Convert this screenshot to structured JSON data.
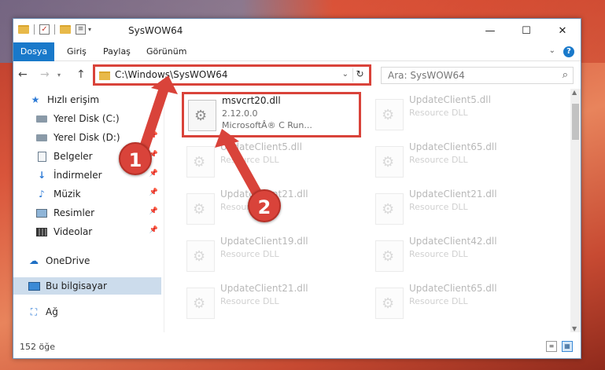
{
  "window": {
    "title": "SysWOW64",
    "minimize_glyph": "—",
    "maximize_glyph": "☐",
    "close_glyph": "✕"
  },
  "ribbon": {
    "tabs": [
      "Dosya",
      "Giriş",
      "Paylaş",
      "Görünüm"
    ],
    "help_glyph": "?"
  },
  "nav": {
    "back_glyph": "←",
    "forward_glyph": "→",
    "history_glyph": "▾",
    "up_glyph": "↑",
    "address": "C:\\Windows\\SysWOW64",
    "search_placeholder": "Ara: SysWOW64"
  },
  "sidebar": {
    "items": [
      {
        "label": "Hızlı erişim",
        "icon": "star-icon",
        "pinned": false
      },
      {
        "label": "Yerel Disk (C:)",
        "icon": "drive-icon",
        "pinned": true
      },
      {
        "label": "Yerel Disk (D:)",
        "icon": "drive-icon",
        "pinned": true
      },
      {
        "label": "Belgeler",
        "icon": "document-icon",
        "pinned": true
      },
      {
        "label": "İndirmeler",
        "icon": "download-icon",
        "pinned": true
      },
      {
        "label": "Müzik",
        "icon": "music-icon",
        "pinned": true
      },
      {
        "label": "Resimler",
        "icon": "picture-icon",
        "pinned": true
      },
      {
        "label": "Videolar",
        "icon": "video-icon",
        "pinned": true
      },
      {
        "label": "OneDrive",
        "icon": "cloud-icon",
        "pinned": false
      },
      {
        "label": "Bu bilgisayar",
        "icon": "computer-icon",
        "pinned": false,
        "selected": true
      },
      {
        "label": "Ağ",
        "icon": "network-icon",
        "pinned": false
      }
    ]
  },
  "files": {
    "highlighted": {
      "name": "msvcrt20.dll",
      "version": "2.12.0.0",
      "description": "MicrosoftÂ® C Run..."
    },
    "left_column": [
      {
        "name": "UpdateClient5.dll",
        "type": "Resource DLL"
      },
      {
        "name": "UpdateClient21.dll",
        "type": "Resource DLL"
      },
      {
        "name": "UpdateClient19.dll",
        "type": "Resource DLL"
      },
      {
        "name": "UpdateClient21.dll",
        "type": "Resource DLL"
      }
    ],
    "right_column": [
      {
        "name": "UpdateClient5.dll",
        "type": "Resource DLL"
      },
      {
        "name": "UpdateClient65.dll",
        "type": "Resource DLL"
      },
      {
        "name": "UpdateClient21.dll",
        "type": "Resource DLL"
      },
      {
        "name": "UpdateClient42.dll",
        "type": "Resource DLL"
      },
      {
        "name": "UpdateClient65.dll",
        "type": "Resource DLL"
      }
    ]
  },
  "status": {
    "item_count": "152 öğe"
  },
  "annotations": {
    "step1": "1",
    "step2": "2",
    "color": "#d9433a"
  }
}
